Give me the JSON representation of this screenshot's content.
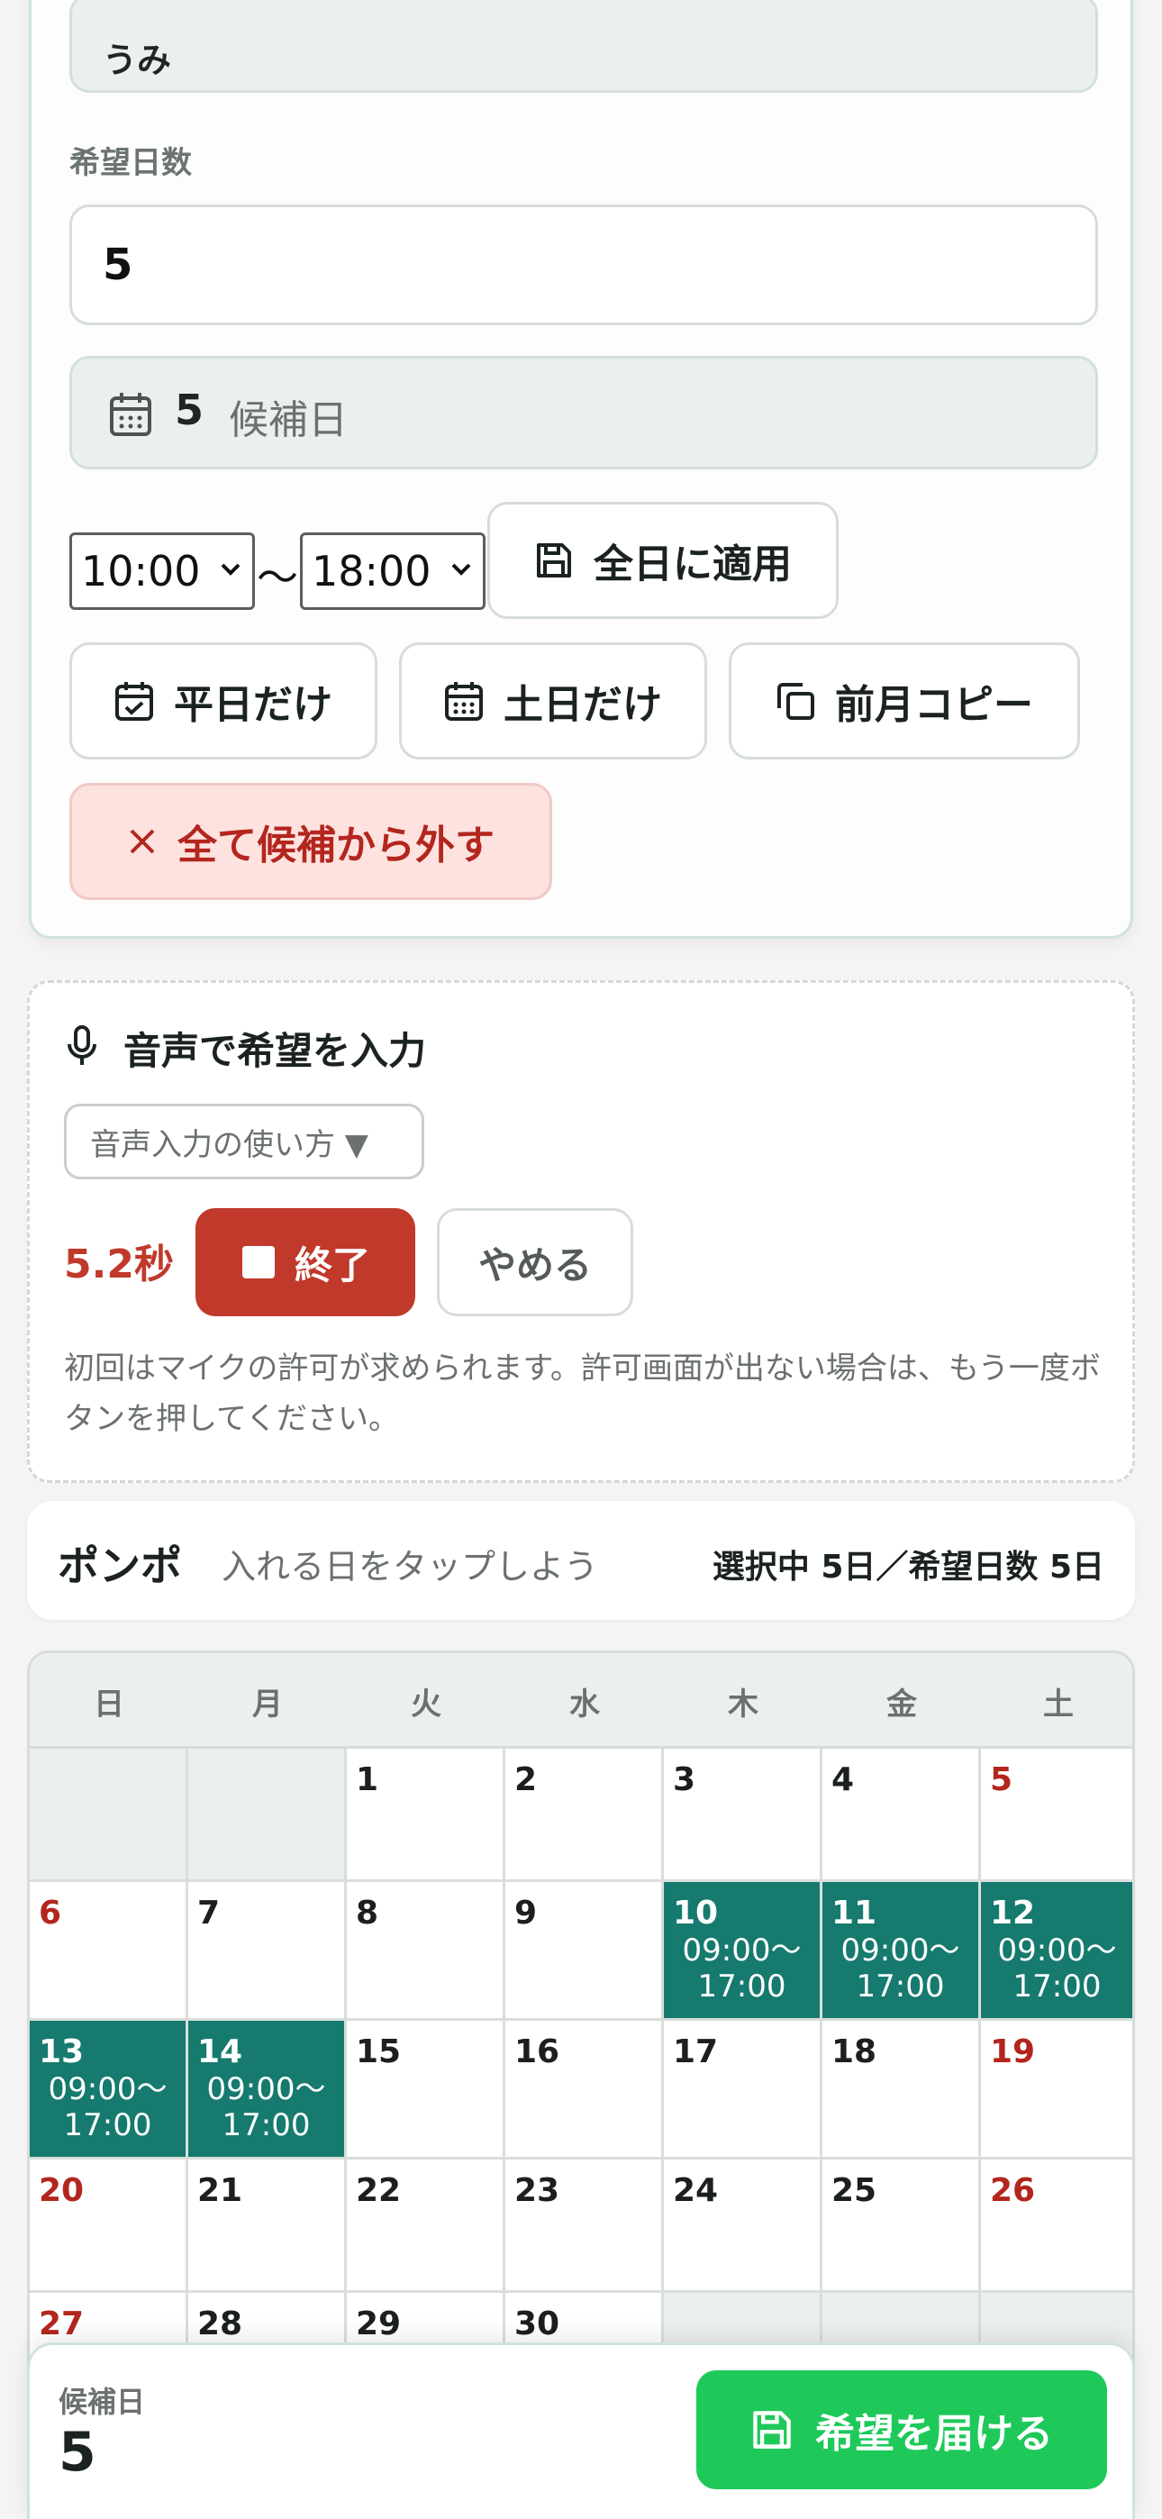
{
  "form": {
    "name_value": "うみ",
    "days_label": "希望日数",
    "days_value": "5",
    "candidate_count": "5",
    "candidate_suffix": "候補日",
    "time_start": "10:00",
    "time_sep": "〜",
    "time_end": "18:00",
    "apply_all_label": "全日に適用",
    "weekdays_label": "平日だけ",
    "weekends_label": "土日だけ",
    "copy_prev_label": "前月コピー",
    "clear_all_label": "全て候補から外す"
  },
  "voice": {
    "title": "音声で希望を入力",
    "howto_label": "音声入力の使い方 ▼",
    "timer": "5.2秒",
    "stop_label": "終了",
    "cancel_label": "やめる",
    "note": "初回はマイクの許可が求められます。許可画面が出ない場合は、もう一度ボタンを押してください。"
  },
  "selection_bar": {
    "brand": "ポンポ",
    "hint": "入れる日をタップしよう",
    "status": "選択中 5日／希望日数 5日"
  },
  "calendar": {
    "weekdays": [
      "日",
      "月",
      "火",
      "水",
      "木",
      "金",
      "土"
    ],
    "time_range_line1": "09:00〜",
    "time_range_line2": "17:00",
    "weeks": [
      [
        null,
        null,
        {
          "d": "1"
        },
        {
          "d": "2"
        },
        {
          "d": "3"
        },
        {
          "d": "4"
        },
        {
          "d": "5",
          "red": true
        }
      ],
      [
        {
          "d": "6",
          "red": true
        },
        {
          "d": "7"
        },
        {
          "d": "8"
        },
        {
          "d": "9"
        },
        {
          "d": "10",
          "sel": true
        },
        {
          "d": "11",
          "sel": true
        },
        {
          "d": "12",
          "sel": true
        }
      ],
      [
        {
          "d": "13",
          "sel": true
        },
        {
          "d": "14",
          "sel": true
        },
        {
          "d": "15"
        },
        {
          "d": "16"
        },
        {
          "d": "17"
        },
        {
          "d": "18"
        },
        {
          "d": "19",
          "red": true
        }
      ],
      [
        {
          "d": "20",
          "red": true
        },
        {
          "d": "21"
        },
        {
          "d": "22"
        },
        {
          "d": "23"
        },
        {
          "d": "24"
        },
        {
          "d": "25"
        },
        {
          "d": "26",
          "red": true
        }
      ],
      [
        {
          "d": "27",
          "red": true
        },
        {
          "d": "28"
        },
        {
          "d": "29"
        },
        {
          "d": "30"
        },
        null,
        null,
        null
      ]
    ]
  },
  "footer": {
    "label": "候補日",
    "count": "5",
    "submit_label": "希望を届ける"
  },
  "colors": {
    "accent_teal": "#167a6e",
    "danger": "#c0392b",
    "submit_green": "#1ec95a",
    "weekend_red": "#b3261e"
  }
}
